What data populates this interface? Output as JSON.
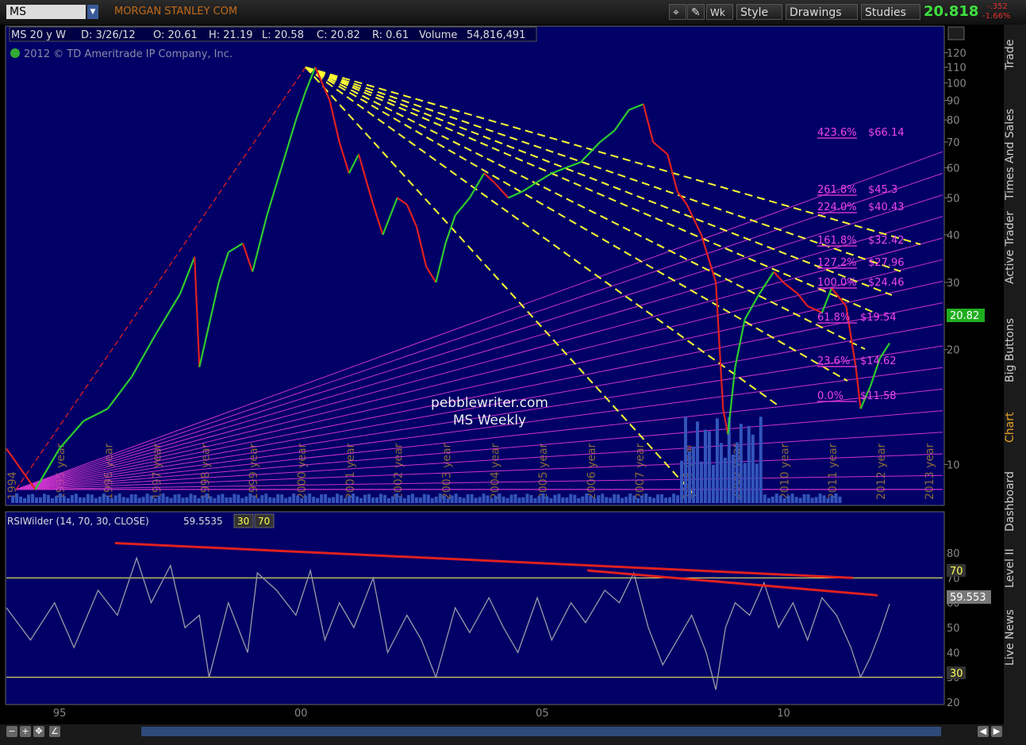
{
  "toolbar": {
    "symbol": "MS",
    "company": "MORGAN STANLEY COM",
    "wk_label": "Wk",
    "style_label": "Style",
    "drawings_label": "Drawings",
    "studies_label": "Studies",
    "last": "20.818",
    "change": "-.352",
    "change_pct": "-1.66%"
  },
  "header": {
    "title": "MS 20 y W",
    "date": "D: 3/26/12",
    "open": "O: 20.61",
    "high": "H: 21.19",
    "low": "L: 20.58",
    "close": "C: 20.82",
    "range": "R: 0.61",
    "volume_label": "Volume",
    "volume": "54,816,491",
    "copyright": "2012 © TD Ameritrade IP Company, Inc."
  },
  "watermark": {
    "line1": "pebblewriter.com",
    "line2": "MS Weekly"
  },
  "sidebar": [
    "Trade",
    "Times And Sales",
    "Active Trader",
    "Big Buttons",
    "Chart",
    "Dashboard",
    "Level II",
    "Live News"
  ],
  "colors": {
    "background": "#000066",
    "price_up": "#2ecc2e",
    "price_down": "#e02020",
    "fan": "#cc33cc",
    "trend": "#ffff33",
    "rsi_line": "#9a9aa8",
    "rsi_trend": "#e02020",
    "badge": "#1fae1f"
  },
  "chart_data": [
    {
      "type": "line",
      "title": "MS 20 y W",
      "scale": "log",
      "ylim": [
        8,
        125
      ],
      "y_ticks": [
        10,
        20,
        30,
        40,
        50,
        60,
        70,
        80,
        90,
        100,
        110,
        120
      ],
      "x_labels": [
        "1994",
        "1995 year",
        "1996 year",
        "1997 year",
        "1998 year",
        "1999 year",
        "2000 year",
        "2001 year",
        "2002 year",
        "2003 year",
        "2004 year",
        "2005 year",
        "2006 year",
        "2007 year",
        "2008 year",
        "2009 year",
        "2010 year",
        "2011 year",
        "2012 year",
        "2013 year"
      ],
      "series": [
        {
          "name": "MS",
          "x": [
            1993.9,
            1994.5,
            1995.0,
            1995.5,
            1996.0,
            1996.5,
            1997.0,
            1997.5,
            1997.8,
            1997.9,
            1998.3,
            1998.5,
            1998.8,
            1999.0,
            1999.3,
            1999.6,
            1999.9,
            2000.1,
            2000.3,
            2000.6,
            2000.8,
            2001.0,
            2001.2,
            2001.5,
            2001.7,
            2002.0,
            2002.2,
            2002.4,
            2002.6,
            2002.8,
            2003.0,
            2003.2,
            2003.5,
            2003.8,
            2004.0,
            2004.3,
            2004.6,
            2004.9,
            2005.2,
            2005.5,
            2005.8,
            2006.2,
            2006.5,
            2006.8,
            2007.1,
            2007.3,
            2007.6,
            2007.8,
            2008.0,
            2008.3,
            2008.6,
            2008.75,
            2008.85,
            2009.0,
            2009.2,
            2009.5,
            2009.8,
            2010.0,
            2010.3,
            2010.5,
            2010.8,
            2011.0,
            2011.3,
            2011.5,
            2011.6,
            2011.7,
            2011.8,
            2012.0,
            2012.2
          ],
          "y": [
            11,
            8.6,
            11,
            13,
            14,
            17,
            22,
            28,
            35,
            18,
            30,
            36,
            38,
            32,
            45,
            60,
            80,
            95,
            110,
            90,
            70,
            58,
            65,
            48,
            40,
            50,
            48,
            42,
            33,
            30,
            38,
            45,
            50,
            58,
            55,
            50,
            52,
            55,
            58,
            60,
            62,
            70,
            75,
            85,
            88,
            70,
            65,
            52,
            48,
            40,
            30,
            14,
            12,
            18,
            24,
            28,
            32,
            30,
            28,
            26,
            25,
            29,
            26,
            18,
            14,
            15,
            16,
            19,
            20.8
          ]
        }
      ],
      "fan_lines": 16,
      "fib_levels": [
        {
          "pct": "423.6%",
          "price": "$66.14"
        },
        {
          "pct": "261.8%",
          "price": "$45.3"
        },
        {
          "pct": "224.0%",
          "price": "$40.43"
        },
        {
          "pct": "161.8%",
          "price": "$32.42"
        },
        {
          "pct": "127.2%",
          "price": "$27.96"
        },
        {
          "pct": "100.0%",
          "price": "$24.46"
        },
        {
          "pct": "61.8%",
          "price": "$19.54"
        },
        {
          "pct": "23.6%",
          "price": "$14.62"
        },
        {
          "pct": "0.0%",
          "price": "$11.58"
        }
      ],
      "price_badge": "20.82"
    },
    {
      "type": "line",
      "title": "RSIWilder (14, 70, 30, CLOSE)",
      "value_label": "59.5535",
      "levels": [
        "30",
        "70"
      ],
      "ylim": [
        20,
        88
      ],
      "y_ticks": [
        20,
        30,
        40,
        50,
        60,
        70,
        80
      ],
      "x_labels": [
        "95",
        "00",
        "05",
        "10"
      ],
      "badge": "59.553",
      "overbought_badge": "70",
      "oversold_badge": "30",
      "series": [
        {
          "name": "RSIWilder",
          "x": [
            1993.9,
            1994.4,
            1994.9,
            1995.3,
            1995.8,
            1996.2,
            1996.6,
            1996.9,
            1997.3,
            1997.6,
            1997.9,
            1998.1,
            1998.5,
            1998.9,
            1999.1,
            1999.5,
            1999.9,
            2000.2,
            2000.5,
            2000.8,
            2001.1,
            2001.5,
            2001.8,
            2002.2,
            2002.5,
            2002.8,
            2003.2,
            2003.5,
            2003.9,
            2004.2,
            2004.5,
            2004.9,
            2005.2,
            2005.6,
            2005.9,
            2006.3,
            2006.6,
            2006.9,
            2007.2,
            2007.5,
            2007.8,
            2008.1,
            2008.4,
            2008.6,
            2008.8,
            2009.0,
            2009.3,
            2009.6,
            2009.9,
            2010.2,
            2010.5,
            2010.8,
            2011.1,
            2011.4,
            2011.6,
            2011.8,
            2012.0,
            2012.2
          ],
          "y": [
            58,
            45,
            60,
            42,
            65,
            55,
            78,
            60,
            75,
            50,
            55,
            30,
            60,
            40,
            72,
            65,
            55,
            73,
            45,
            60,
            50,
            70,
            40,
            55,
            45,
            30,
            58,
            48,
            62,
            50,
            40,
            62,
            45,
            60,
            52,
            65,
            60,
            72,
            50,
            35,
            45,
            55,
            40,
            25,
            50,
            60,
            55,
            68,
            50,
            60,
            45,
            62,
            55,
            42,
            30,
            38,
            48,
            59.55
          ]
        }
      ]
    }
  ]
}
